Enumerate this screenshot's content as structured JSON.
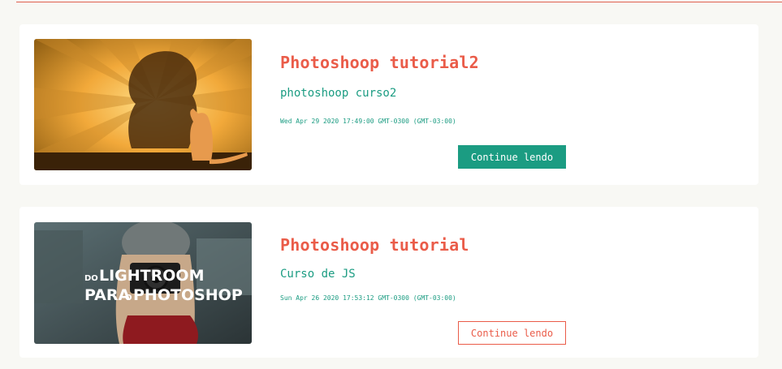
{
  "posts": [
    {
      "title": "Photoshoop tutorial2",
      "subtitle": "photoshoop curso2",
      "date": "Wed Apr 29 2020 17:49:00 GMT-0300 (GMT-03:00)",
      "button_label": "Continue lendo",
      "thumbnail": "lion-shadow-cat-image"
    },
    {
      "title": "Photoshoop tutorial",
      "subtitle": "Curso de JS",
      "date": "Sun Apr 26 2020 17:53:12 GMT-0300 (GMT-03:00)",
      "button_label": "Continue lendo",
      "thumbnail": "camera-girl-image",
      "thumbnail_text": {
        "line1_small": "DO",
        "line1_big": "LIGHTROOM",
        "line2_big_a": "PARA",
        "line2_small": "O",
        "line2_big_b": "PHOTOSHOP"
      }
    }
  ],
  "colors": {
    "accent": "#ea5c49",
    "green": "#1b9c82",
    "background": "#f8f8f4",
    "card": "#ffffff"
  }
}
